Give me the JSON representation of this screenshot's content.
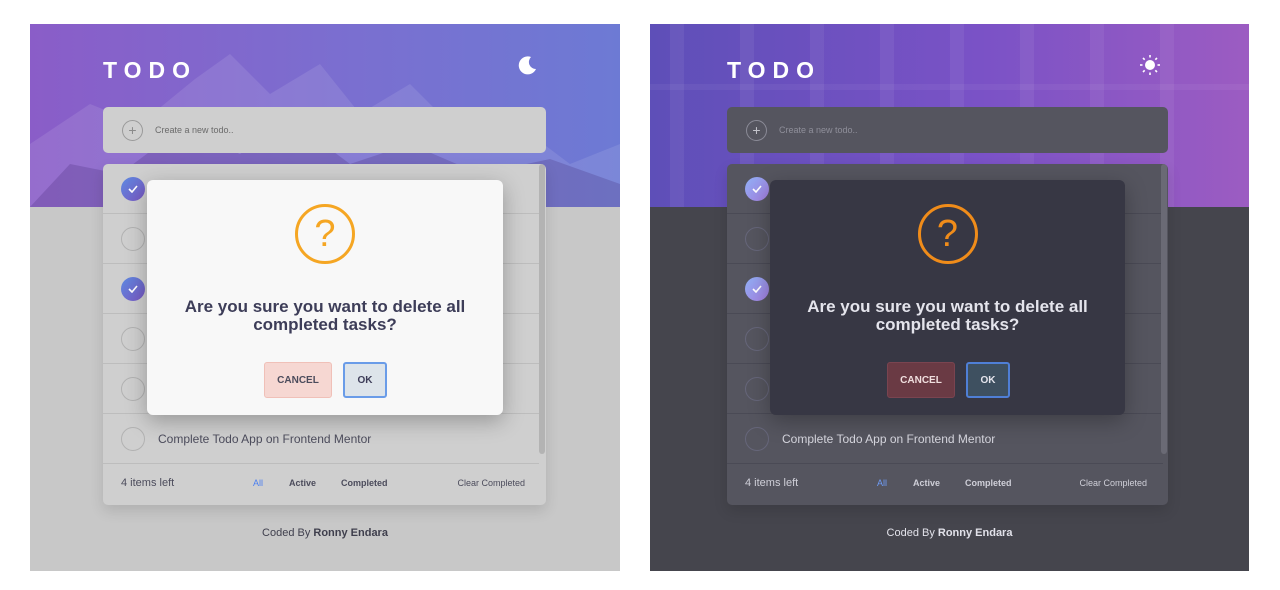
{
  "app": {
    "title": "TODO"
  },
  "new_todo": {
    "placeholder": "Create a new todo.."
  },
  "todos": [
    {
      "text": "",
      "completed": true
    },
    {
      "text": "",
      "completed": false
    },
    {
      "text": "",
      "completed": true
    },
    {
      "text": "",
      "completed": false
    },
    {
      "text": "",
      "completed": false
    },
    {
      "text": "Complete Todo App on Frontend Mentor",
      "completed": false
    }
  ],
  "footer": {
    "items_left": "4 items left",
    "filters": [
      "All",
      "Active",
      "Completed"
    ],
    "active_filter": "All",
    "clear": "Clear Completed"
  },
  "credit": {
    "prefix": "Coded By ",
    "author": "Ronny Endara"
  },
  "dialog": {
    "icon": "question-icon",
    "message": "Are you sure you want to delete all completed tasks?",
    "cancel_label": "CANCEL",
    "ok_label": "OK"
  },
  "themes": {
    "light": {
      "toggle_icon": "moon-icon",
      "accent": "#4b7ff0"
    },
    "dark": {
      "toggle_icon": "sun-icon",
      "accent": "#6f9cf7"
    }
  }
}
